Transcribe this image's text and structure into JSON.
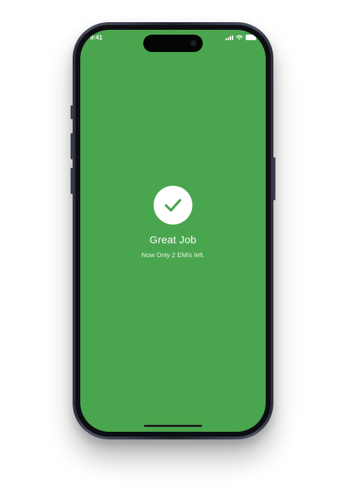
{
  "status_bar": {
    "time": "9:41"
  },
  "success": {
    "title": "Great Job",
    "subtitle": "Now Only 2 EMIs left.",
    "icon": "checkmark-icon"
  },
  "colors": {
    "screen_background": "#4aa64e",
    "check_circle": "#ffffff",
    "checkmark": "#4aa64e"
  }
}
